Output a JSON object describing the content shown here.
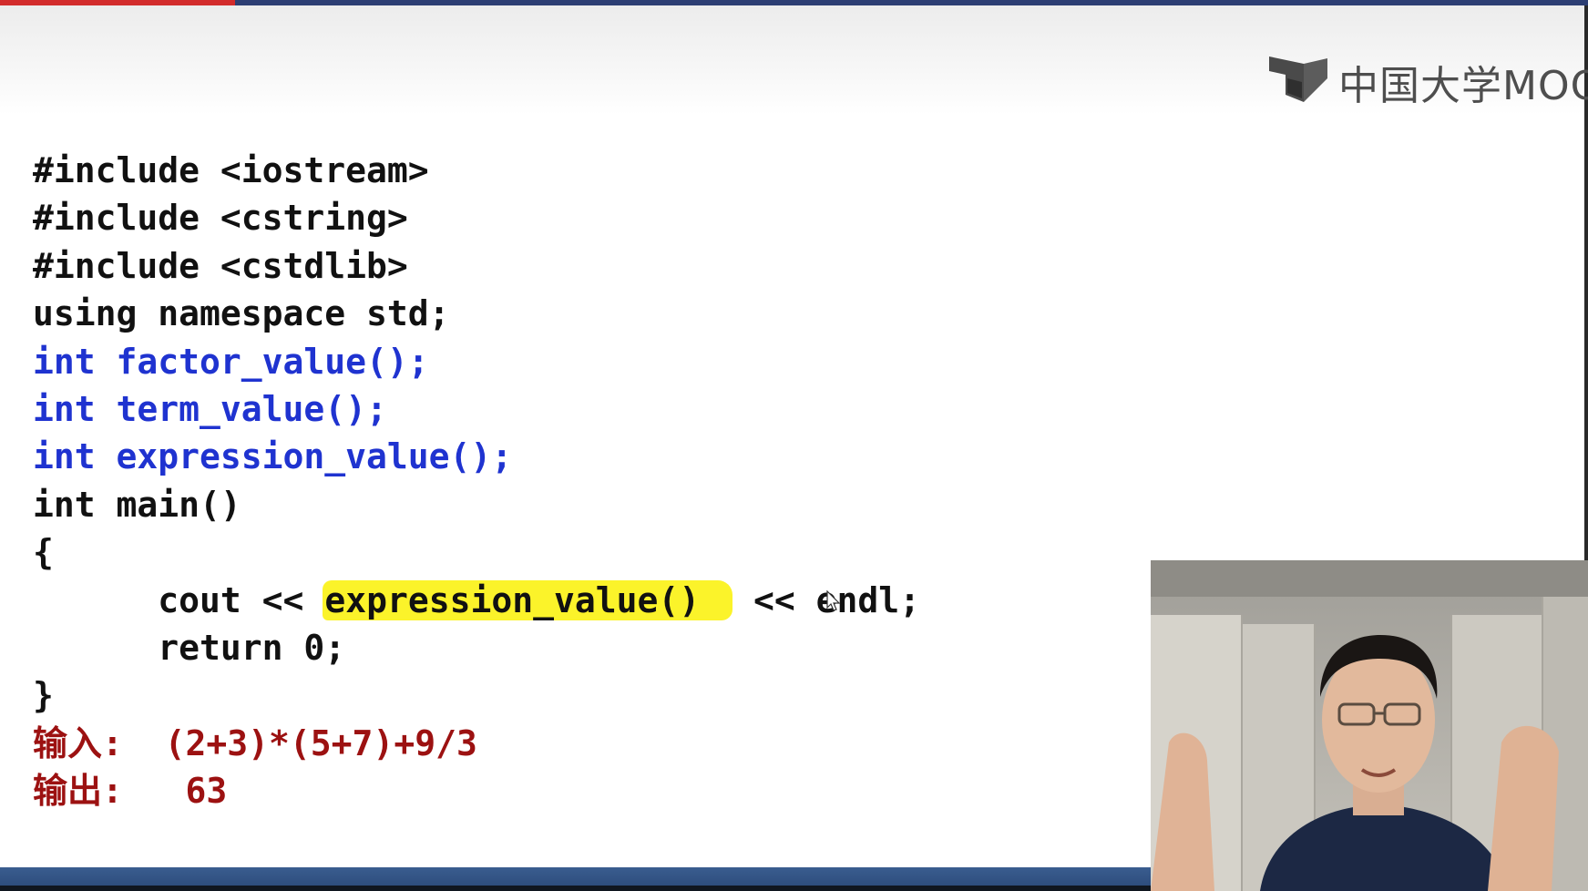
{
  "player": {
    "progress_fraction": 0.148,
    "brand_colors": {
      "progress": "#d22b2b",
      "track": "#2c3e73"
    }
  },
  "logo": {
    "text": "中国大学MOOC",
    "icon": "mooc-book-icon"
  },
  "code": {
    "lines": [
      "#include <iostream>",
      "#include <cstring>",
      "#include <cstdlib>",
      "using namespace std;",
      "int factor_value();",
      "int term_value();",
      "int expression_value();",
      "int main()",
      "{",
      "cout << ",
      "expression_value()",
      "<< endl;",
      "return 0;",
      "}"
    ],
    "indent": "      ",
    "colors": {
      "normal": "#111111",
      "declaration": "#1f33d0",
      "example": "#9c1111",
      "highlight": "#fbf32a"
    }
  },
  "example": {
    "input_label": "输入:",
    "input_value": "(2+3)*(5+7)+9/3",
    "output_label": "输出:",
    "output_value": "63"
  },
  "video": {
    "content": "lecturer-webcam"
  }
}
